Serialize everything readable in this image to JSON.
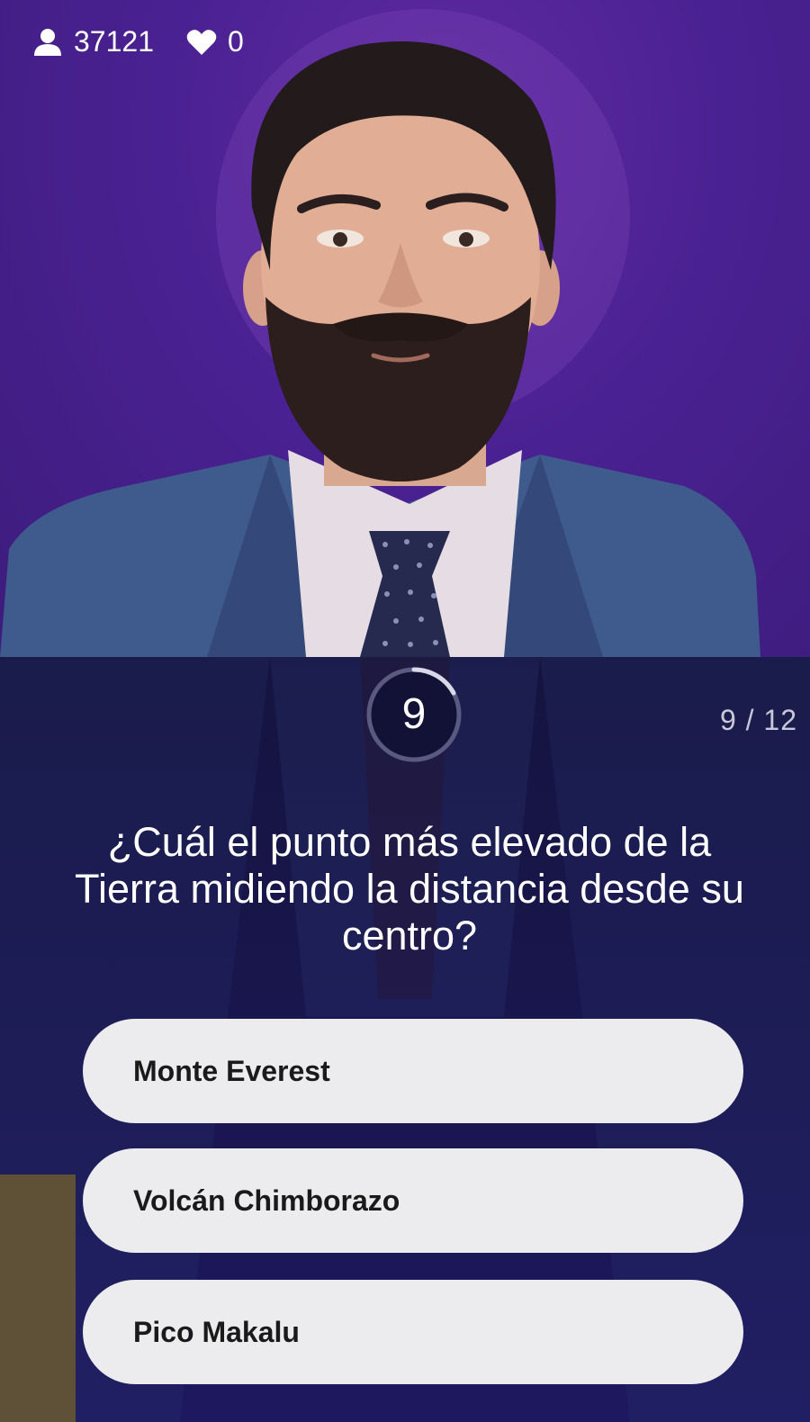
{
  "stats": {
    "viewers_icon": "user-icon",
    "viewers": "37121",
    "lives_icon": "heart-icon",
    "lives": "0"
  },
  "timer": {
    "value": "9"
  },
  "progress": "9 / 12",
  "question": "¿Cuál el punto más elevado de la Tierra midiendo la distancia desde su centro?",
  "answers": [
    {
      "label": "Monte Everest"
    },
    {
      "label": "Volcán Chimborazo"
    },
    {
      "label": "Pico Makalu"
    }
  ],
  "colors": {
    "background_top": "#4a2192",
    "panel": "#1a1650",
    "answer_button": "#ececee",
    "text": "#ffffff"
  }
}
